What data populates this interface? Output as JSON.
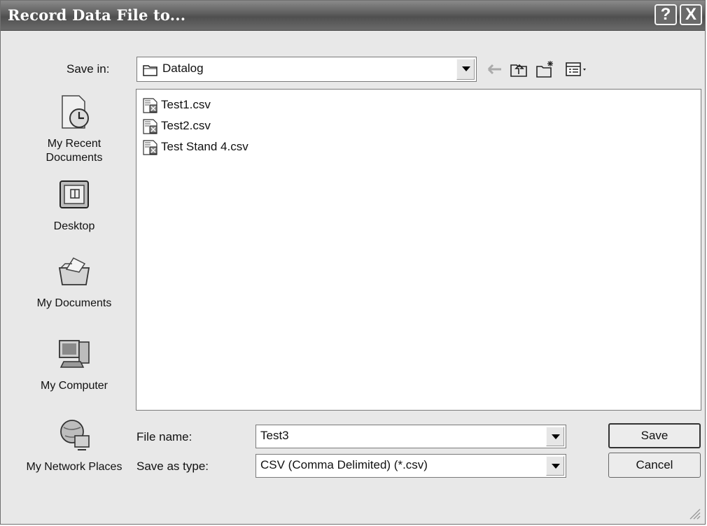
{
  "window": {
    "title": "Record Data File to...",
    "help_glyph": "?",
    "close_glyph": "X"
  },
  "save_in": {
    "label": "Save in:",
    "value": "Datalog"
  },
  "toolbar": {
    "icons": [
      "back-arrow-icon",
      "up-one-level-icon",
      "new-folder-icon",
      "view-menu-icon"
    ]
  },
  "places": [
    {
      "label": "My Recent Documents",
      "icon": "recent-documents-icon"
    },
    {
      "label": "Desktop",
      "icon": "desktop-icon"
    },
    {
      "label": "My Documents",
      "icon": "my-documents-icon"
    },
    {
      "label": "My Computer",
      "icon": "my-computer-icon"
    },
    {
      "label": "My Network Places",
      "icon": "network-places-icon"
    }
  ],
  "files": [
    {
      "name": "Test1.csv"
    },
    {
      "name": "Test2.csv"
    },
    {
      "name": "Test Stand 4.csv"
    }
  ],
  "file_name": {
    "label": "File name:",
    "value": "Test3"
  },
  "save_as_type": {
    "label": "Save as type:",
    "value": "CSV (Comma Delimited) (*.csv)"
  },
  "buttons": {
    "save": "Save",
    "cancel": "Cancel"
  }
}
